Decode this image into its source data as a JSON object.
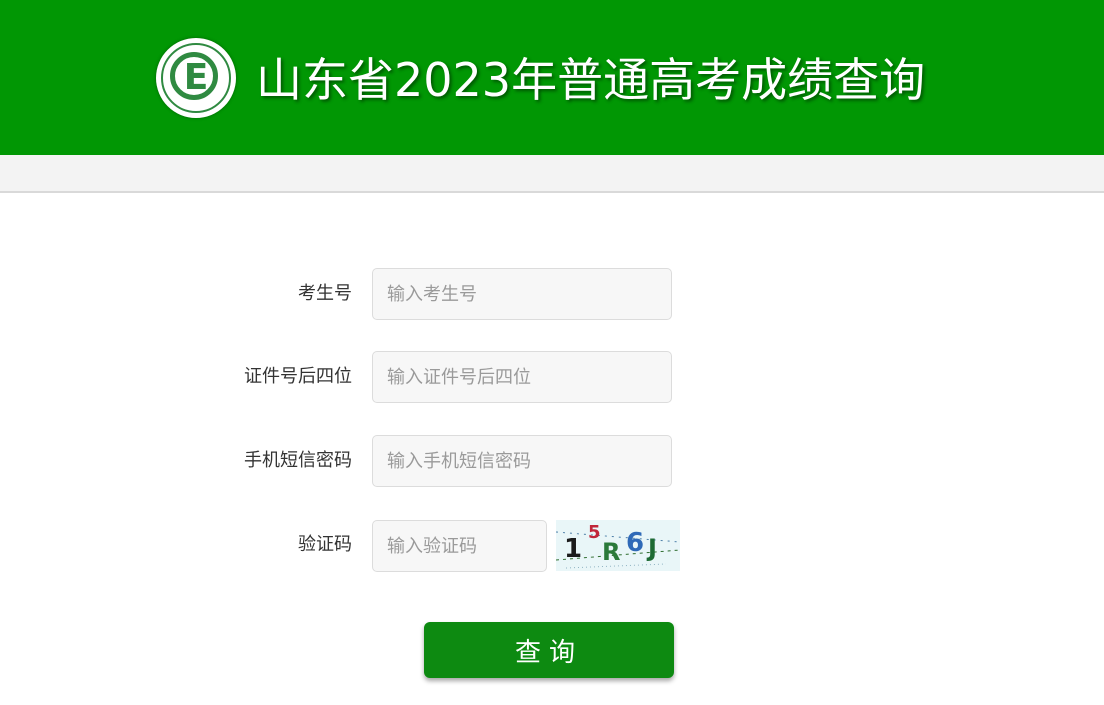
{
  "header": {
    "logo_letter": "E",
    "title": "山东省2023年普通高考成绩查询"
  },
  "form": {
    "exam_number": {
      "label": "考生号",
      "placeholder": "输入考生号",
      "value": ""
    },
    "id_last4": {
      "label": "证件号后四位",
      "placeholder": "输入证件号后四位",
      "value": ""
    },
    "sms_code": {
      "label": "手机短信密码",
      "placeholder": "输入手机短信密码",
      "value": ""
    },
    "captcha": {
      "label": "验证码",
      "placeholder": "输入验证码",
      "value": "",
      "image_text": [
        "1",
        "5",
        "R",
        "6",
        "J"
      ]
    },
    "submit_label": "查询"
  },
  "colors": {
    "header_bg": "#019704",
    "button_bg": "#0d8a11",
    "field_bg": "#f7f7f7",
    "subbar_bg": "#f3f3f3"
  }
}
